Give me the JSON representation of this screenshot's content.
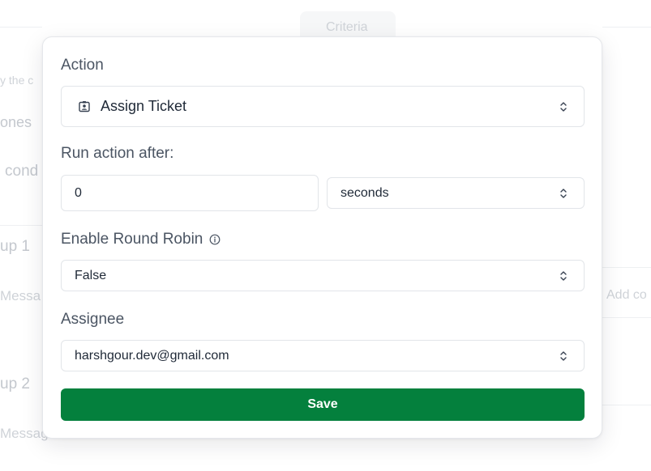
{
  "background": {
    "criteria_tab": "Criteria",
    "fragments": {
      "line1": "y the c",
      "line2": "ones",
      "line3": "cond",
      "group1": "up 1",
      "message1": "Messa",
      "add_condition": "Add co",
      "group2": "up 2",
      "message2": "Messag"
    }
  },
  "modal": {
    "action": {
      "label": "Action",
      "value": "Assign Ticket",
      "icon": "contact-card-icon"
    },
    "run_after": {
      "label": "Run action after:",
      "amount": "0",
      "unit": "seconds"
    },
    "round_robin": {
      "label": "Enable Round Robin",
      "value": "False",
      "icon": "info-icon"
    },
    "assignee": {
      "label": "Assignee",
      "value": "harshgour.dev@gmail.com"
    },
    "save_label": "Save"
  },
  "colors": {
    "primary": "#04803d",
    "label_text": "#4b5563",
    "border": "#e2e5e9"
  }
}
